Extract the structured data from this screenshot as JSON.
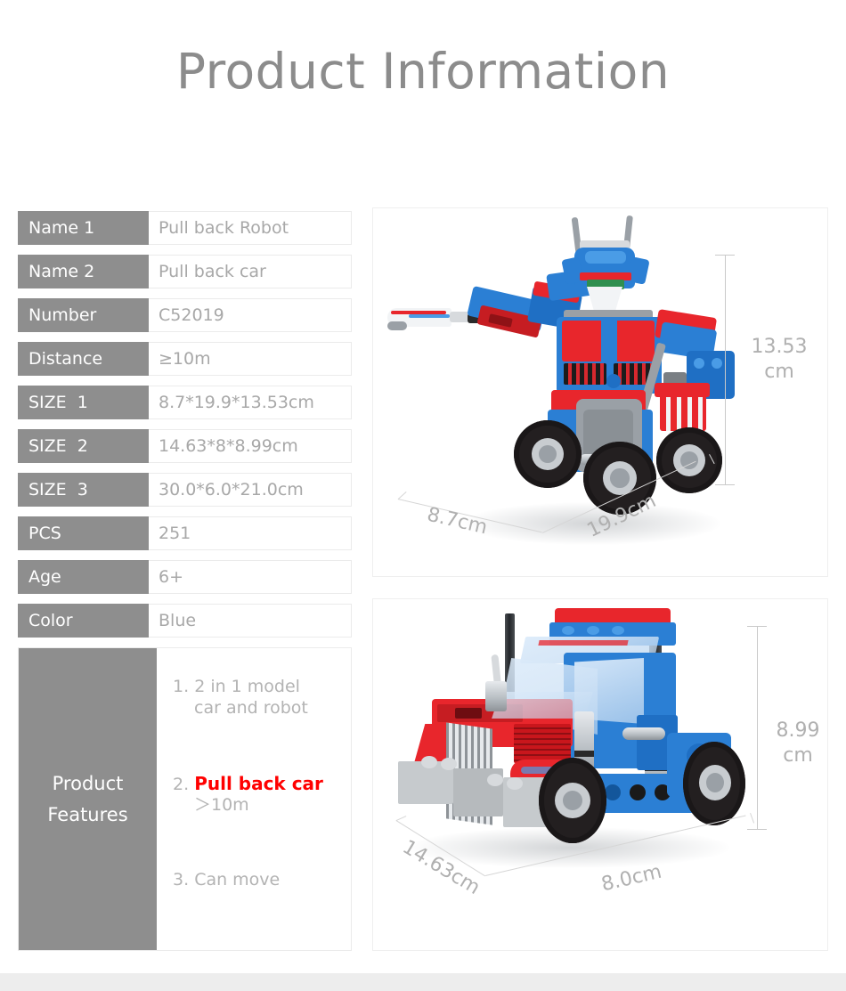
{
  "header": {
    "title": "Product Information"
  },
  "spec_table": {
    "rows": [
      {
        "label": "Name 1",
        "value": "Pull back Robot"
      },
      {
        "label": "Name 2",
        "value": "Pull back car"
      },
      {
        "label": "Number",
        "value": "C52019"
      },
      {
        "label": "Distance",
        "value": "≥10m"
      },
      {
        "label": "SIZE  1",
        "value": "8.7*19.9*13.53cm"
      },
      {
        "label": "SIZE  2",
        "value": "14.63*8*8.99cm"
      },
      {
        "label": "SIZE  3",
        "value": "30.0*6.0*21.0cm"
      },
      {
        "label": "PCS",
        "value": "251"
      },
      {
        "label": "Age",
        "value": "6+"
      },
      {
        "label": "Color",
        "value": "Blue"
      }
    ]
  },
  "features": {
    "label_line1": "Product",
    "label_line2": "Features",
    "items": [
      {
        "num": "1.",
        "text": "2 in 1 model",
        "text2": "car and robot",
        "highlight": false
      },
      {
        "num": "2.",
        "text": "Pull back car",
        "text2": "＞10m",
        "highlight": true
      },
      {
        "num": "3.",
        "text": "Can move",
        "text2": "",
        "highlight": false
      }
    ]
  },
  "photos": {
    "robot": {
      "name": "pull-back-robot-photo",
      "dim_height": "13.53",
      "dim_height_unit": "cm",
      "dim_width": "8.7cm",
      "dim_depth": "19.9cm"
    },
    "truck": {
      "name": "pull-back-truck-photo",
      "dim_height": "8.99",
      "dim_height_unit": "cm",
      "dim_width": "14.63cm",
      "dim_depth": "8.0cm"
    }
  },
  "colors": {
    "label_gray": "#8e8e8e",
    "value_text": "#a8a8a8",
    "title_gray": "#8c8c8c",
    "highlight_red": "#ff0000",
    "panel_border": "#efefef",
    "footer_band": "#ededed",
    "brick_blue": "#2b7fd4",
    "brick_red": "#e8262c"
  },
  "footer": {
    "band_visible": true
  }
}
